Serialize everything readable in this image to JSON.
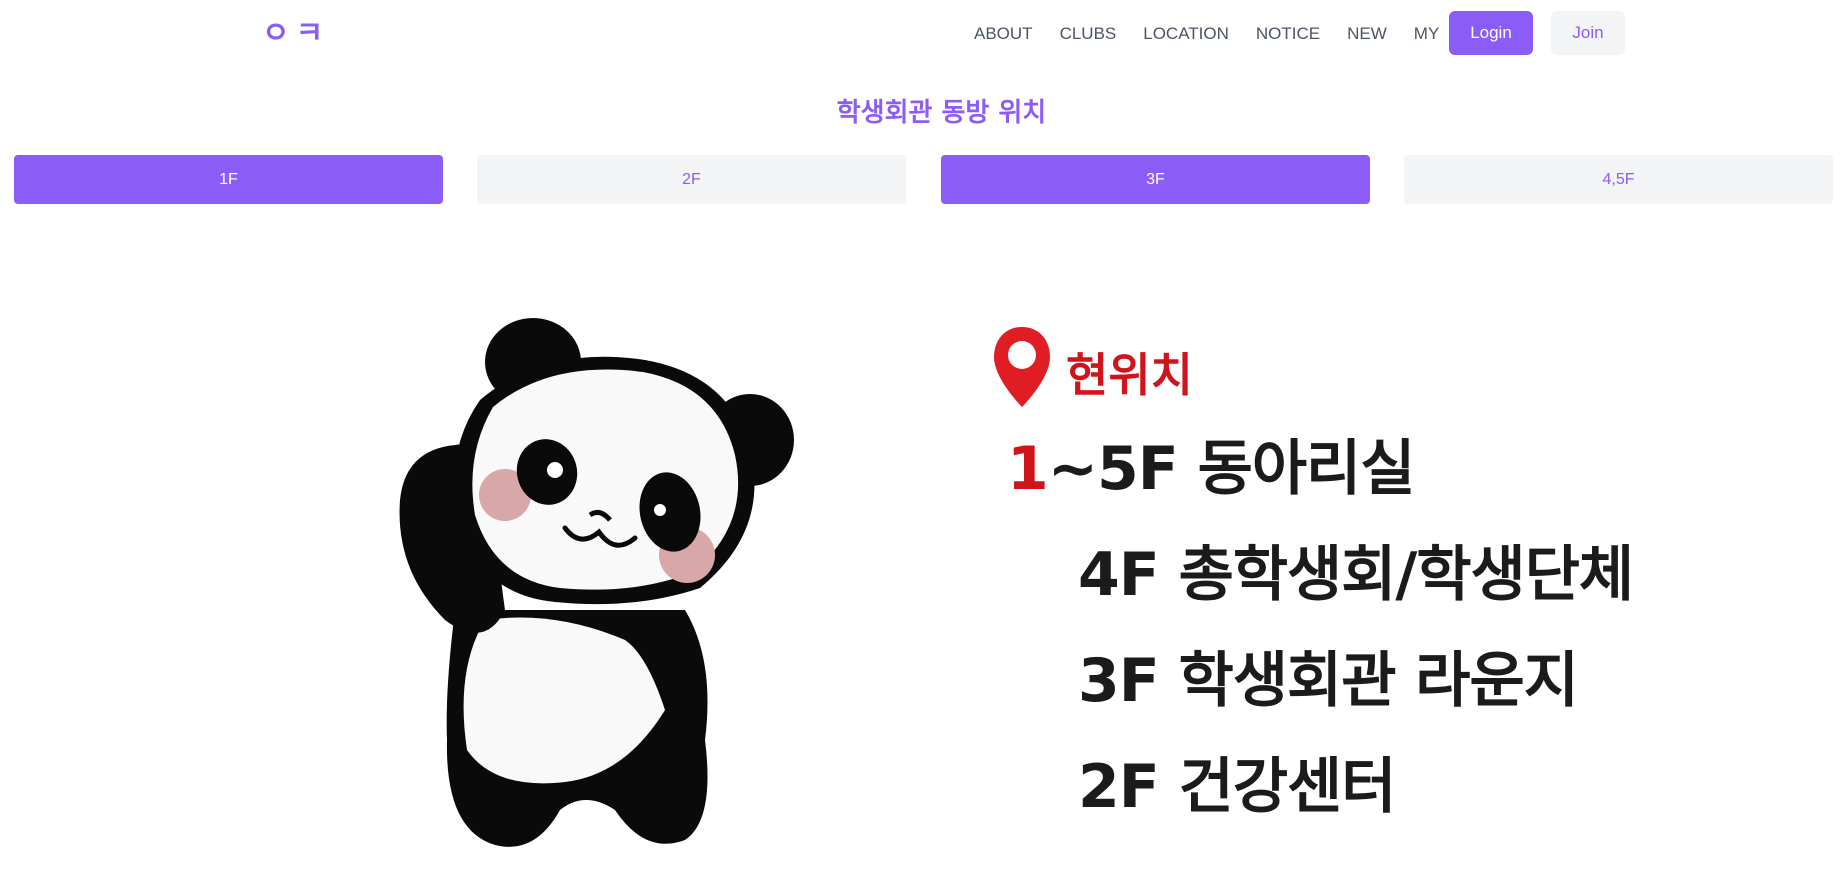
{
  "header": {
    "logo": "ㅇㅋ",
    "nav": [
      "ABOUT",
      "CLUBS",
      "LOCATION",
      "NOTICE",
      "NEW",
      "MY"
    ],
    "login_label": "Login",
    "join_label": "Join"
  },
  "page_title": "학생회관 동방 위치",
  "tabs": [
    {
      "label": "1F",
      "active": true
    },
    {
      "label": "2F",
      "active": false
    },
    {
      "label": "3F",
      "active": true
    },
    {
      "label": "4,5F",
      "active": false
    }
  ],
  "location": {
    "title": "현위치",
    "line1_accent": "1",
    "line1_rest": "~5F 동아리실",
    "line2": "4F 총학생회/학생단체",
    "line3": "3F 학생회관 라운지",
    "line4": "2F 건강센터"
  },
  "colors": {
    "accent": "#8b5cf6",
    "tab_inactive_bg": "#f3f4f6",
    "marker_red": "#d0141b"
  }
}
